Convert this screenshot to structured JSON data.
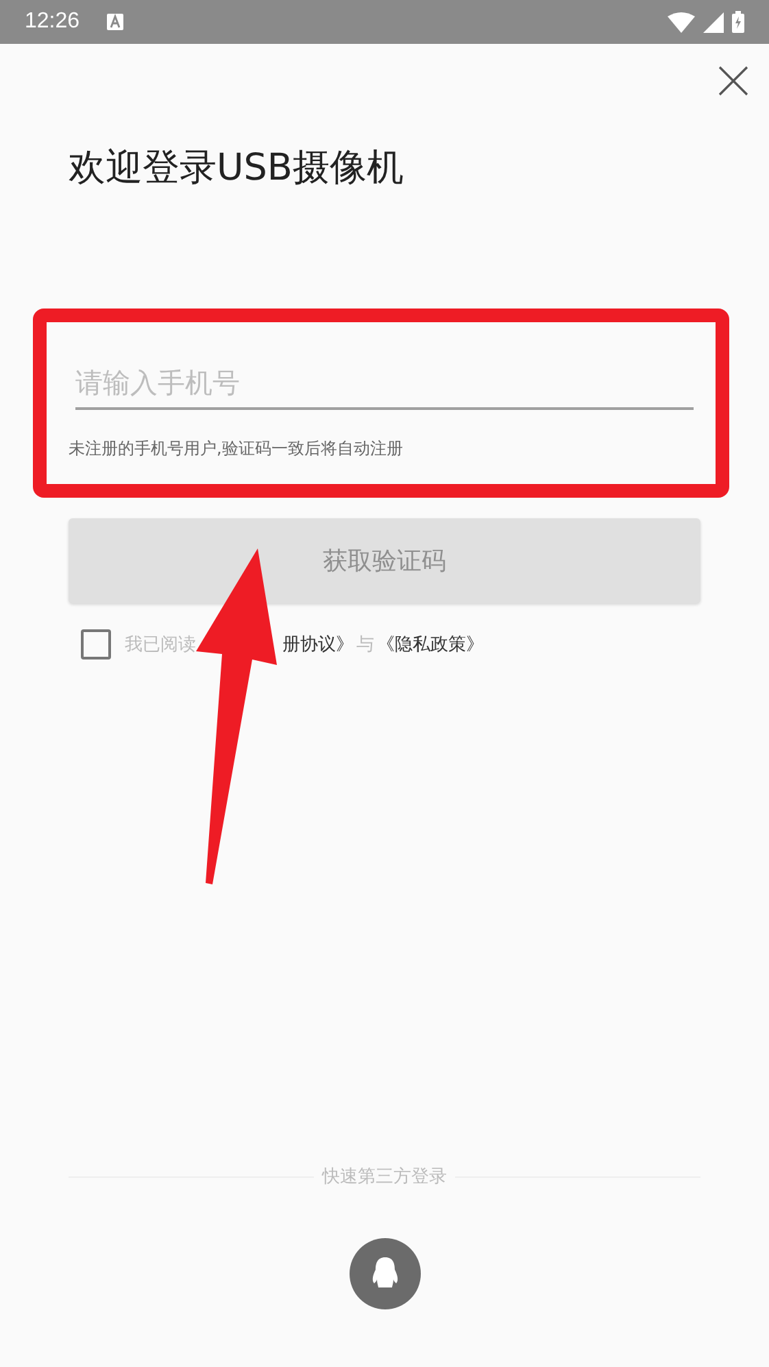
{
  "status_bar": {
    "time": "12:26"
  },
  "title": "欢迎登录USB摄像机",
  "phone_field": {
    "placeholder": "请输入手机号"
  },
  "hint": "未注册的手机号用户,验证码一致后将自动注册",
  "code_button": {
    "label": "获取验证码",
    "disabled": true
  },
  "consent": {
    "checked": false,
    "prefix": "我已阅读",
    "agreement_link": "册协议》",
    "joiner": "与",
    "privacy_link": "《隐私政策》"
  },
  "third_party": {
    "label": "快速第三方登录"
  }
}
